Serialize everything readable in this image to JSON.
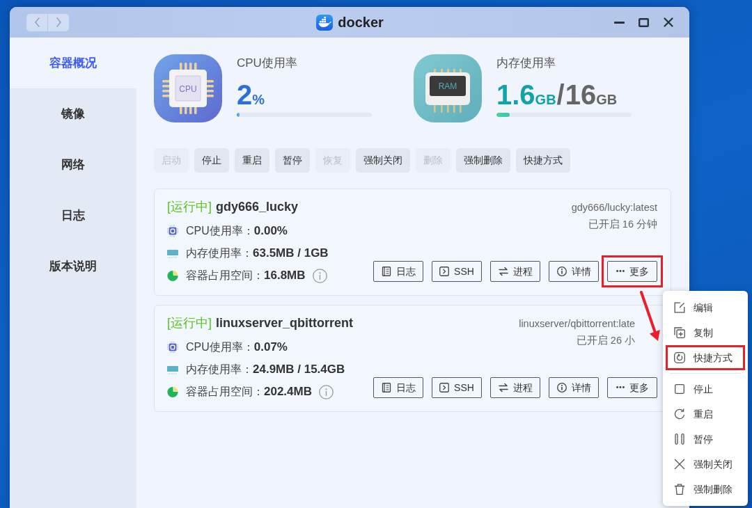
{
  "window": {
    "title": "docker"
  },
  "sidebar": {
    "items": [
      {
        "label": "容器概况",
        "selected": true
      },
      {
        "label": "镜像",
        "selected": false
      },
      {
        "label": "网络",
        "selected": false
      },
      {
        "label": "日志",
        "selected": false
      },
      {
        "label": "版本说明",
        "selected": false
      }
    ]
  },
  "overview": [
    {
      "kind": "cpu",
      "icon_label": "CPU",
      "title": "CPU使用率",
      "value": "2",
      "unit": "%",
      "level": 0.02
    },
    {
      "kind": "memory",
      "icon_label": "RAM",
      "title": "内存使用率",
      "value": "1.6",
      "unit": "GB",
      "separator": "/",
      "total": "16",
      "total_unit": "GB",
      "level": 0.1
    }
  ],
  "toolbar": [
    {
      "label": "启动",
      "disabled": true
    },
    {
      "label": "停止",
      "disabled": false
    },
    {
      "label": "重启",
      "disabled": false
    },
    {
      "label": "暂停",
      "disabled": false
    },
    {
      "label": "恢复",
      "disabled": true
    },
    {
      "label": "强制关闭",
      "disabled": false
    },
    {
      "label": "删除",
      "disabled": true
    },
    {
      "label": "强制删除",
      "disabled": false
    },
    {
      "label": "快捷方式",
      "disabled": false
    }
  ],
  "containers": [
    {
      "status": "[运行中]",
      "name": "gdy666_lucky",
      "image": "gdy666/lucky:latest",
      "uptime": "已开启 16 分钟",
      "stats": [
        {
          "kind": "cpu",
          "label": "CPU使用率：",
          "value": "0.00%"
        },
        {
          "kind": "memory",
          "label": "内存使用率：",
          "value": "63.5MB / 1GB"
        },
        {
          "kind": "disk",
          "label": "容器占用空间：",
          "value": "16.8MB"
        }
      ],
      "actions": [
        {
          "kind": "log",
          "label": "日志",
          "highlighted": false
        },
        {
          "kind": "ssh",
          "label": "SSH",
          "highlighted": false
        },
        {
          "kind": "process",
          "label": "进程",
          "highlighted": false
        },
        {
          "kind": "details",
          "label": "详情",
          "highlighted": false
        },
        {
          "kind": "more",
          "label": "更多",
          "highlighted": true
        }
      ]
    },
    {
      "status": "[运行中]",
      "name": "linuxserver_qbittorrent",
      "image": "linuxserver/qbittorrent:late",
      "uptime": "已开启 26 小",
      "stats": [
        {
          "kind": "cpu",
          "label": "CPU使用率：",
          "value": "0.07%"
        },
        {
          "kind": "memory",
          "label": "内存使用率：",
          "value": "24.9MB / 15.4GB"
        },
        {
          "kind": "disk",
          "label": "容器占用空间：",
          "value": "202.4MB"
        }
      ],
      "actions": [
        {
          "kind": "log",
          "label": "日志",
          "highlighted": false
        },
        {
          "kind": "ssh",
          "label": "SSH",
          "highlighted": false
        },
        {
          "kind": "process",
          "label": "进程",
          "highlighted": false
        },
        {
          "kind": "details",
          "label": "详情",
          "highlighted": false
        },
        {
          "kind": "more",
          "label": "更多",
          "highlighted": false
        }
      ]
    }
  ],
  "more_menu": {
    "groups": [
      [
        {
          "kind": "edit",
          "label": "编辑",
          "highlighted": false
        },
        {
          "kind": "copy",
          "label": "复制",
          "highlighted": false
        },
        {
          "kind": "shortcut",
          "label": "快捷方式",
          "highlighted": true
        }
      ],
      [
        {
          "kind": "stop",
          "label": "停止",
          "highlighted": false
        },
        {
          "kind": "restart",
          "label": "重启",
          "highlighted": false
        },
        {
          "kind": "pause",
          "label": "暂停",
          "highlighted": false
        },
        {
          "kind": "force_close",
          "label": "强制关闭",
          "highlighted": false
        },
        {
          "kind": "delete",
          "label": "强制删除",
          "highlighted": false
        }
      ]
    ]
  },
  "annotation_arrow": true
}
